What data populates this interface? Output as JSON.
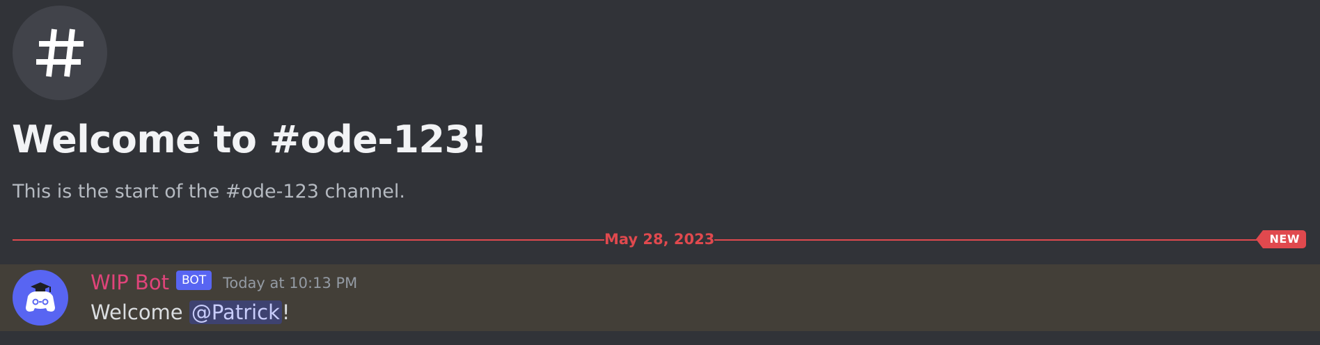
{
  "channel": {
    "welcome_title": "Welcome to #ode-123!",
    "welcome_subtitle": "This is the start of the #ode-123 channel.",
    "icon": "hash-icon"
  },
  "divider": {
    "date": "May 28, 2023",
    "new_label": "NEW",
    "color": "#e0494e"
  },
  "message": {
    "author": "WIP Bot",
    "author_color": "#e0447a",
    "bot_tag": "BOT",
    "timestamp": "Today at 10:13 PM",
    "text_before": "Welcome ",
    "mention": "@Patrick",
    "text_after": "!",
    "avatar_icon": "discord-bot-graduate-avatar",
    "highlight_color": "#433f38"
  }
}
